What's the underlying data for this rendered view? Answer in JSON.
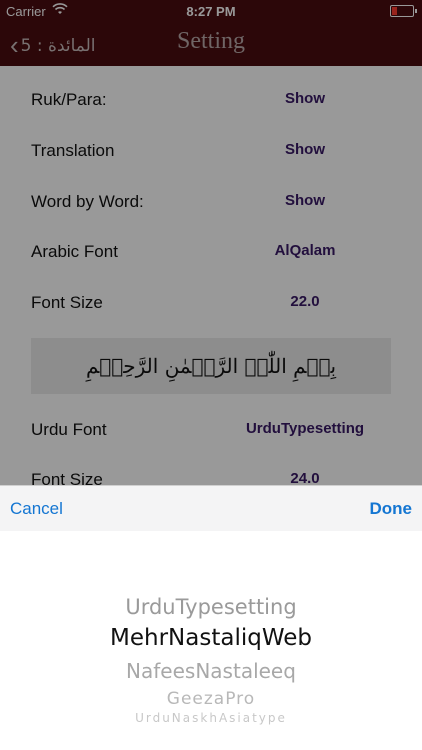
{
  "status_bar": {
    "carrier": "Carrier",
    "time": "8:27 PM"
  },
  "navbar": {
    "back_label": "5 : المائدة",
    "title": "Setting"
  },
  "settings": [
    {
      "label": "Ruk/Para:",
      "value": "Show"
    },
    {
      "label": "Translation",
      "value": "Show"
    },
    {
      "label": "Word by Word:",
      "value": "Show"
    },
    {
      "label": "Arabic Font",
      "value": "AlQalam"
    },
    {
      "label": "Font Size",
      "value": "22.0"
    }
  ],
  "bismillah": "بِسۡمِ اللّٰہِ الرَّحۡمٰنِ الرَّحِیۡمِ",
  "settings_more": [
    {
      "label": "Urdu Font",
      "value": "UrduTypesetting"
    },
    {
      "label": "Font Size",
      "value": "24.0"
    }
  ],
  "toolbar": {
    "cancel_label": "Cancel",
    "done_label": "Done"
  },
  "picker": {
    "options": [
      "UrduTypesetting",
      "MehrNastaliqWeb",
      "NafeesNastaleeq",
      "GeezaPro",
      "UrduNaskhAsiatype"
    ],
    "selected": "MehrNastaliqWeb"
  },
  "colors": {
    "navbar": "#4a0d10",
    "value_text": "#3a1a66",
    "toolbar_button": "#1476d2"
  }
}
